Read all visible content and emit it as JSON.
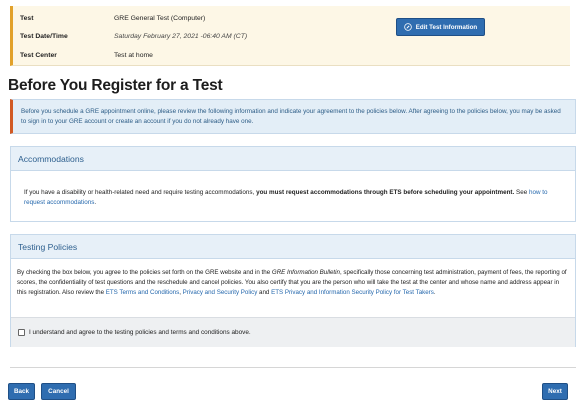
{
  "summary": {
    "rows": [
      {
        "label": "Test",
        "value": "GRE General Test (Computer)"
      },
      {
        "label": "Test Date/Time",
        "value": "Saturday February 27, 2021 -06:40 AM (CT)"
      },
      {
        "label": "Test Center",
        "value": "Test at home"
      }
    ],
    "edit_button": "Edit Test Information",
    "edit_icon": "edit-icon"
  },
  "page_title": "Before You Register for a Test",
  "notice": "Before you schedule a GRE appointment online, please review the following information and indicate your agreement to the policies below. After agreeing to the policies below, you may be asked to sign in to your GRE account or create an account if you do not already have one.",
  "accommodations": {
    "heading": "Accommodations",
    "text_1": "If you have a disability or health-related need and require testing accommodations, ",
    "text_bold": "you must request accommodations through ETS before scheduling your appointment.",
    "text_2": " See ",
    "link": "how to request accommodations",
    "text_3": "."
  },
  "policies": {
    "heading": "Testing Policies",
    "p1": "By checking the box below, you agree to the policies set forth on the GRE website and in the ",
    "bulletin": "GRE Information Bulletin",
    "p2": ", specifically those concerning test administration, payment of fees, the reporting of scores, the confidentiality of test questions and the reschedule and cancel policies. You also certify that you are the person who will take the test at the center and whose name and address appear in this registration. Also review the ",
    "link1": "ETS Terms and Conditions",
    "sep": ", ",
    "link2": "Privacy and Security Policy",
    "and": " and ",
    "link3": "ETS Privacy and Information Security Policy for Test Takers",
    "end": ".",
    "checkbox_label": "I understand and agree to the testing policies and terms and conditions above."
  },
  "buttons": {
    "back": "Back",
    "cancel": "Cancel",
    "next": "Next"
  }
}
